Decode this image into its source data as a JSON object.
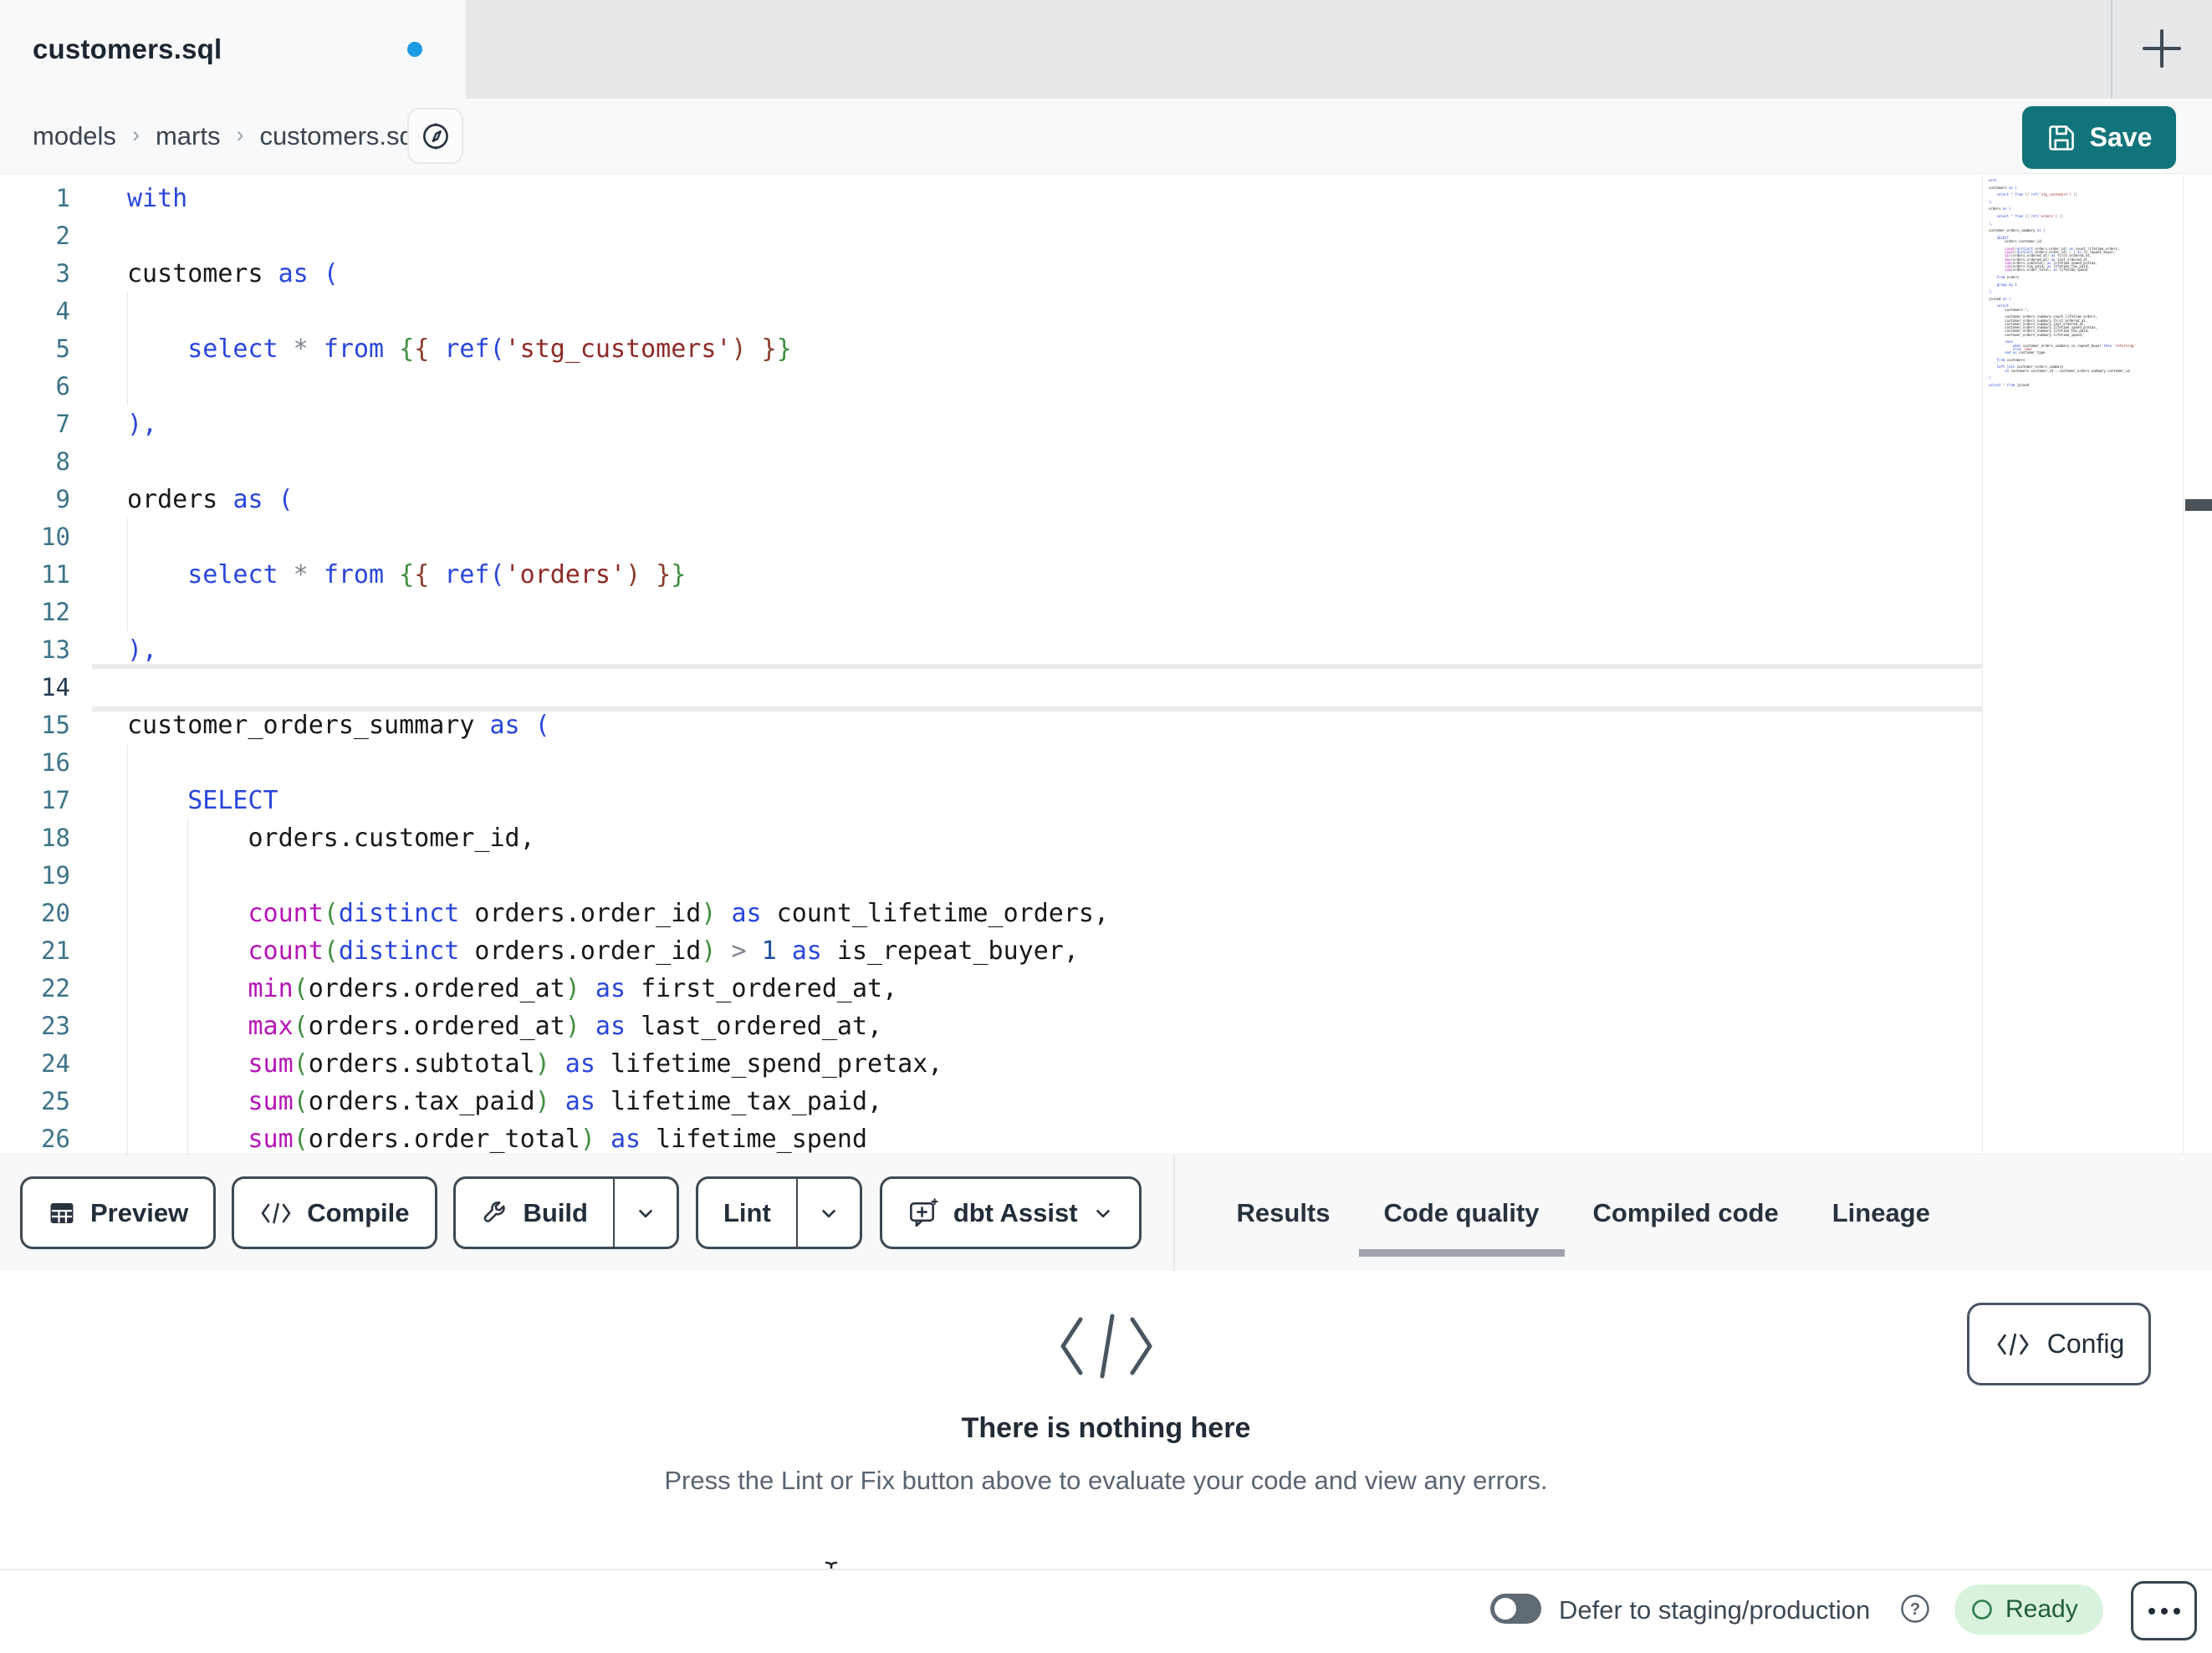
{
  "tab_bar": {
    "tab_title": "customers.sql",
    "new_tab_label": "+"
  },
  "breadcrumb": {
    "items": [
      "models",
      "marts",
      "customers.sql"
    ],
    "separator": "›"
  },
  "save_button": {
    "label": "Save"
  },
  "toolbar": {
    "preview_label": "Preview",
    "compile_label": "Compile",
    "build_label": "Build",
    "lint_label": "Lint",
    "dbt_assist_label": "dbt Assist"
  },
  "panel_tabs": {
    "items": [
      "Results",
      "Code quality",
      "Compiled code",
      "Lineage"
    ],
    "active": "Code quality"
  },
  "empty_state": {
    "title": "There is nothing here",
    "description": "Press the Lint or Fix button above to evaluate your code and view any errors.",
    "config_label": "Config"
  },
  "status_bar": {
    "defer_label": "Defer to staging/production",
    "ready_label": "Ready"
  },
  "colors": {
    "save_teal": "#12747B",
    "unsaved_dot_blue": "#1B9BE2",
    "tabstrip_gray": "#E5E7E8",
    "active_tab_bg": "#F8F9FA",
    "line_number": "#3C7389",
    "active_tab_underline": "#9FA5AB",
    "ready_badge_bg": "#D9F2DD",
    "ready_badge_text": "#215B3C",
    "ready_badge_ring": "#2F7D4E",
    "button_border": "#3D4953"
  },
  "editor": {
    "active_line": 14,
    "visible_line_count": 26,
    "token_colors": {
      "kw": "#2946DB",
      "id": "#16181B",
      "op": "#7D858D",
      "str": "#8E2A28",
      "fn": "#B515B5",
      "pg": "#3F8F3F",
      "pm": "#8A3B2B",
      "pb": "#2946DB",
      "num": "#1F4F9C"
    },
    "lines": [
      {
        "t": [
          [
            "kw",
            "with"
          ]
        ]
      },
      {},
      {
        "t": [
          [
            "id",
            "customers "
          ],
          [
            "kw",
            "as"
          ],
          [
            "pb",
            " ("
          ]
        ]
      },
      {
        "g": [
          0
        ]
      },
      {
        "g": [
          0
        ],
        "t": [
          [
            "id",
            "    "
          ],
          [
            "kw",
            "select"
          ],
          [
            "op",
            " * "
          ],
          [
            "kw",
            "from"
          ],
          [
            "id",
            " "
          ],
          [
            "pg",
            "{"
          ],
          [
            "pm",
            "{"
          ],
          [
            "id",
            " "
          ],
          [
            "kw",
            "ref"
          ],
          [
            "pb",
            "("
          ],
          [
            "str",
            "'stg_customers'"
          ],
          [
            "pm",
            ")"
          ],
          [
            "id",
            " "
          ],
          [
            "pm",
            "}"
          ],
          [
            "pg",
            "}"
          ]
        ]
      },
      {
        "g": [
          0
        ]
      },
      {
        "t": [
          [
            "pb",
            "),"
          ]
        ]
      },
      {},
      {
        "t": [
          [
            "id",
            "orders "
          ],
          [
            "kw",
            "as"
          ],
          [
            "pb",
            " ("
          ]
        ]
      },
      {
        "g": [
          0
        ]
      },
      {
        "g": [
          0
        ],
        "t": [
          [
            "id",
            "    "
          ],
          [
            "kw",
            "select"
          ],
          [
            "op",
            " * "
          ],
          [
            "kw",
            "from"
          ],
          [
            "id",
            " "
          ],
          [
            "pg",
            "{"
          ],
          [
            "pm",
            "{"
          ],
          [
            "id",
            " "
          ],
          [
            "kw",
            "ref"
          ],
          [
            "pb",
            "("
          ],
          [
            "str",
            "'orders'"
          ],
          [
            "pm",
            ")"
          ],
          [
            "id",
            " "
          ],
          [
            "pm",
            "}"
          ],
          [
            "pg",
            "}"
          ]
        ]
      },
      {
        "g": [
          0
        ]
      },
      {
        "t": [
          [
            "pb",
            "),"
          ]
        ]
      },
      {},
      {
        "t": [
          [
            "id",
            "customer_orders_summary "
          ],
          [
            "kw",
            "as"
          ],
          [
            "pb",
            " ("
          ]
        ]
      },
      {
        "g": [
          0
        ]
      },
      {
        "g": [
          0
        ],
        "t": [
          [
            "id",
            "    "
          ],
          [
            "kw",
            "SELECT"
          ]
        ]
      },
      {
        "g": [
          0,
          4
        ],
        "t": [
          [
            "id",
            "        orders.customer_id,"
          ]
        ]
      },
      {
        "g": [
          0,
          4
        ]
      },
      {
        "g": [
          0,
          4
        ],
        "t": [
          [
            "id",
            "        "
          ],
          [
            "fn",
            "count"
          ],
          [
            "pg",
            "("
          ],
          [
            "kw",
            "distinct"
          ],
          [
            "id",
            " orders.order_id"
          ],
          [
            "pg",
            ")"
          ],
          [
            "kw",
            " as"
          ],
          [
            "id",
            " count_lifetime_orders,"
          ]
        ]
      },
      {
        "g": [
          0,
          4
        ],
        "t": [
          [
            "id",
            "        "
          ],
          [
            "fn",
            "count"
          ],
          [
            "pg",
            "("
          ],
          [
            "kw",
            "distinct"
          ],
          [
            "id",
            " orders.order_id"
          ],
          [
            "pg",
            ")"
          ],
          [
            "op",
            " > "
          ],
          [
            "num",
            "1"
          ],
          [
            "kw",
            " as"
          ],
          [
            "id",
            " is_repeat_buyer,"
          ]
        ]
      },
      {
        "g": [
          0,
          4
        ],
        "t": [
          [
            "id",
            "        "
          ],
          [
            "fn",
            "min"
          ],
          [
            "pg",
            "("
          ],
          [
            "id",
            "orders.ordered_at"
          ],
          [
            "pg",
            ")"
          ],
          [
            "kw",
            " as"
          ],
          [
            "id",
            " first_ordered_at,"
          ]
        ]
      },
      {
        "g": [
          0,
          4
        ],
        "t": [
          [
            "id",
            "        "
          ],
          [
            "fn",
            "max"
          ],
          [
            "pg",
            "("
          ],
          [
            "id",
            "orders.ordered_at"
          ],
          [
            "pg",
            ")"
          ],
          [
            "kw",
            " as"
          ],
          [
            "id",
            " last_ordered_at,"
          ]
        ]
      },
      {
        "g": [
          0,
          4
        ],
        "t": [
          [
            "id",
            "        "
          ],
          [
            "fn",
            "sum"
          ],
          [
            "pg",
            "("
          ],
          [
            "id",
            "orders.subtotal"
          ],
          [
            "pg",
            ")"
          ],
          [
            "kw",
            " as"
          ],
          [
            "id",
            " lifetime_spend_pretax,"
          ]
        ]
      },
      {
        "g": [
          0,
          4
        ],
        "t": [
          [
            "id",
            "        "
          ],
          [
            "fn",
            "sum"
          ],
          [
            "pg",
            "("
          ],
          [
            "id",
            "orders.tax_paid"
          ],
          [
            "pg",
            ")"
          ],
          [
            "kw",
            " as"
          ],
          [
            "id",
            " lifetime_tax_paid,"
          ]
        ]
      },
      {
        "g": [
          0,
          4
        ],
        "t": [
          [
            "id",
            "        "
          ],
          [
            "fn",
            "sum"
          ],
          [
            "pg",
            "("
          ],
          [
            "id",
            "orders.order_total"
          ],
          [
            "pg",
            ")"
          ],
          [
            "kw",
            " as"
          ],
          [
            "id",
            " lifetime_spend"
          ]
        ]
      },
      {},
      {
        "t": [
          [
            "id",
            "    "
          ],
          [
            "kw",
            "from"
          ],
          [
            "id",
            " orders"
          ]
        ]
      },
      {},
      {
        "t": [
          [
            "id",
            "    "
          ],
          [
            "kw",
            "group by"
          ],
          [
            "num",
            " 1"
          ]
        ]
      },
      {},
      {
        "t": [
          [
            "pb",
            "),"
          ]
        ]
      },
      {},
      {
        "t": [
          [
            "id",
            "joined "
          ],
          [
            "kw",
            "as"
          ],
          [
            "pb",
            " ("
          ]
        ]
      },
      {},
      {
        "t": [
          [
            "id",
            "    "
          ],
          [
            "kw",
            "select"
          ]
        ]
      },
      {
        "t": [
          [
            "id",
            "        customers."
          ],
          [
            "op",
            "*"
          ],
          [
            "id",
            ","
          ]
        ]
      },
      {},
      {
        "t": [
          [
            "id",
            "        customer_orders_summary.count_lifetime_orders,"
          ]
        ]
      },
      {
        "t": [
          [
            "id",
            "        customer_orders_summary.first_ordered_at,"
          ]
        ]
      },
      {
        "t": [
          [
            "id",
            "        customer_orders_summary.last_ordered_at,"
          ]
        ]
      },
      {
        "t": [
          [
            "id",
            "        customer_orders_summary.lifetime_spend_pretax,"
          ]
        ]
      },
      {
        "t": [
          [
            "id",
            "        customer_orders_summary.lifetime_tax_paid,"
          ]
        ]
      },
      {
        "t": [
          [
            "id",
            "        customer_orders_summary.lifetime_spend,"
          ]
        ]
      },
      {},
      {
        "t": [
          [
            "id",
            "        "
          ],
          [
            "kw",
            "case"
          ]
        ]
      },
      {
        "t": [
          [
            "id",
            "            "
          ],
          [
            "kw",
            "when"
          ],
          [
            "id",
            " customer_orders_summary.is_repeat_buyer "
          ],
          [
            "kw",
            "then"
          ],
          [
            "str",
            " 'returning'"
          ]
        ]
      },
      {
        "t": [
          [
            "id",
            "            "
          ],
          [
            "kw",
            "else"
          ],
          [
            "str",
            " 'new'"
          ]
        ]
      },
      {
        "t": [
          [
            "id",
            "        "
          ],
          [
            "kw",
            "end"
          ],
          [
            "kw",
            " as"
          ],
          [
            "id",
            " customer_type"
          ]
        ]
      },
      {},
      {
        "t": [
          [
            "id",
            "    "
          ],
          [
            "kw",
            "from"
          ],
          [
            "id",
            " customers"
          ]
        ]
      },
      {},
      {
        "t": [
          [
            "id",
            "    "
          ],
          [
            "kw",
            "left join"
          ],
          [
            "id",
            " customer_orders_summary"
          ]
        ]
      },
      {
        "t": [
          [
            "id",
            "        "
          ],
          [
            "kw",
            "on"
          ],
          [
            "id",
            " customers.customer_id "
          ],
          [
            "op",
            "="
          ],
          [
            "id",
            " customer_orders_summary.customer_id"
          ]
        ]
      },
      {},
      {
        "t": [
          [
            "pb",
            ")"
          ]
        ]
      },
      {},
      {
        "t": [
          [
            "kw",
            "select"
          ],
          [
            "op",
            " * "
          ],
          [
            "kw",
            "from"
          ],
          [
            "id",
            " joined"
          ]
        ]
      }
    ]
  }
}
